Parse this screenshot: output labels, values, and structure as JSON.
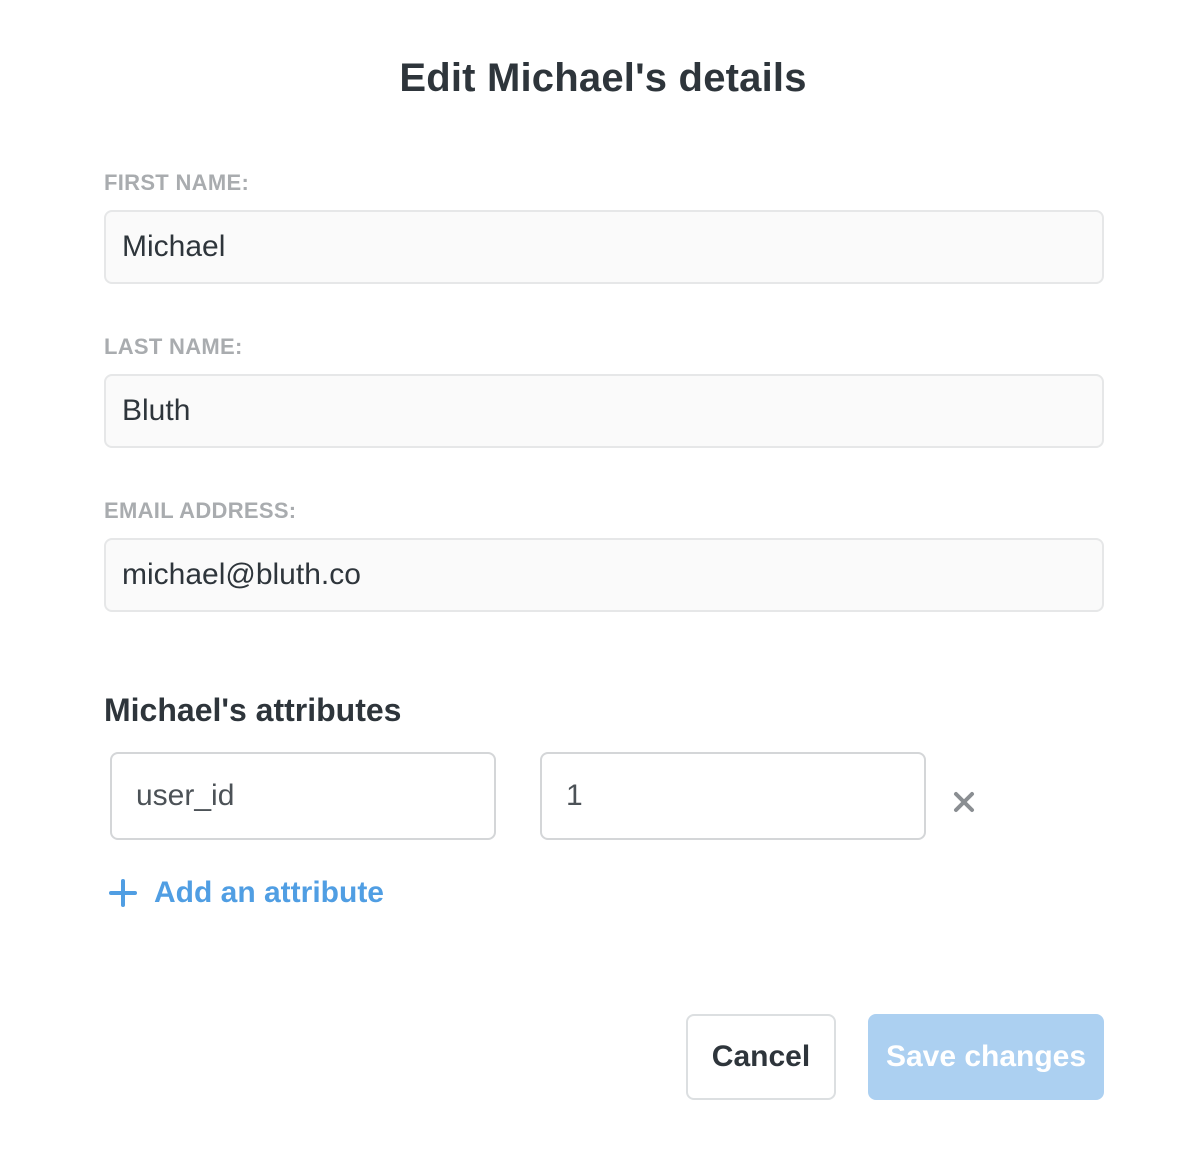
{
  "dialog": {
    "title": "Edit Michael's details"
  },
  "form": {
    "first_name": {
      "label": "FIRST NAME:",
      "value": "Michael"
    },
    "last_name": {
      "label": "LAST NAME:",
      "value": "Bluth"
    },
    "email": {
      "label": "EMAIL ADDRESS:",
      "value": "michael@bluth.co"
    }
  },
  "attributes": {
    "heading": "Michael's attributes",
    "items": [
      {
        "key": "user_id",
        "value": "1"
      }
    ],
    "add_label": "Add an attribute",
    "remove_icon": "close-icon",
    "add_icon": "plus-icon"
  },
  "actions": {
    "cancel_label": "Cancel",
    "save_label": "Save changes"
  },
  "colors": {
    "accent": "#509ee3",
    "save_disabled_bg": "#acd0f1",
    "label_gray": "#a9acaf",
    "text_dark": "#2e353b"
  }
}
